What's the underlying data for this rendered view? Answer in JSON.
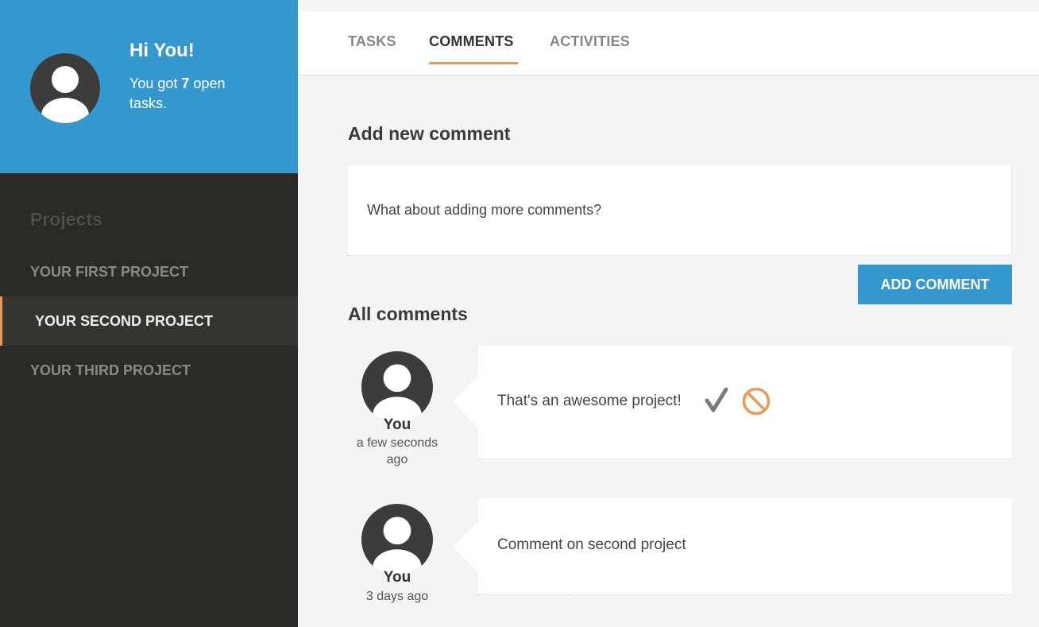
{
  "user": {
    "greeting": "Hi You!",
    "open_tasks_prefix": "You got ",
    "open_tasks_count": "7",
    "open_tasks_suffix": " open tasks."
  },
  "sidebar": {
    "heading": "Projects",
    "projects": [
      {
        "label": "YOUR FIRST PROJECT",
        "active": false
      },
      {
        "label": "YOUR SECOND PROJECT",
        "active": true
      },
      {
        "label": "YOUR THIRD PROJECT",
        "active": false
      }
    ]
  },
  "tabs": [
    {
      "label": "TASKS",
      "active": false
    },
    {
      "label": "COMMENTS",
      "active": true
    },
    {
      "label": "ACTIVITIES",
      "active": false
    }
  ],
  "new_comment": {
    "heading": "Add new comment",
    "placeholder": "What about adding more comments?",
    "button_label": "ADD COMMENT"
  },
  "comments": {
    "heading": "All comments",
    "items": [
      {
        "author": "You",
        "time": "a few seconds ago",
        "text": "That's an awesome project!",
        "actions": [
          "check-icon",
          "block-icon"
        ]
      },
      {
        "author": "You",
        "time": "3 days ago",
        "text": "Comment on second project",
        "actions": []
      }
    ]
  },
  "colors": {
    "accent_blue": "#3498cf",
    "accent_orange": "#e79a56",
    "sidebar_bg": "#2b2a27"
  }
}
